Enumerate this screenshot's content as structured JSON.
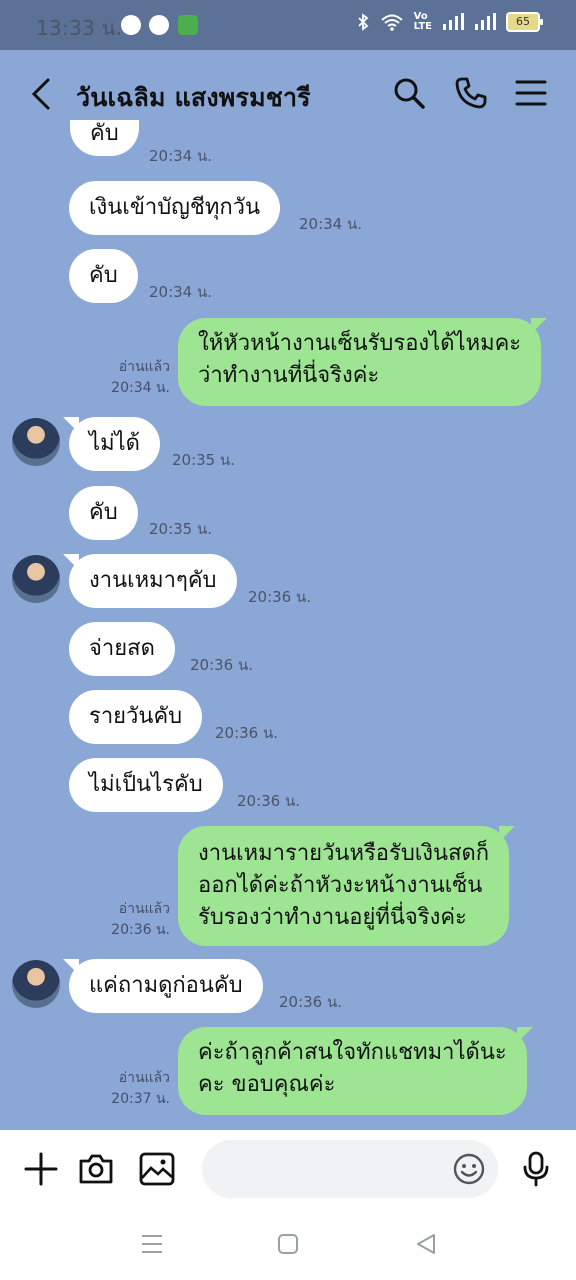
{
  "status": {
    "time": "13:33 น.",
    "battery": "65"
  },
  "header": {
    "title": "วันเฉลิม แสงพรมชารี"
  },
  "messages": [
    {
      "text": "คับ",
      "time": "20:34 น."
    },
    {
      "text": "เงินเข้าบัญชีทุกวัน",
      "time": "20:34 น."
    },
    {
      "text": "คับ",
      "time": "20:34 น."
    },
    {
      "lines": [
        "ให้หัวหน้างานเซ็นรับรองได้ไหมคะ",
        "ว่าทำงานที่นี่จริงค่ะ"
      ],
      "read": "อ่านแล้ว",
      "time": "20:34 น."
    },
    {
      "text": "ไม่ได้",
      "time": "20:35 น."
    },
    {
      "text": "คับ",
      "time": "20:35 น."
    },
    {
      "text": "งานเหมาๆคับ",
      "time": "20:36 น."
    },
    {
      "text": "จ่ายสด",
      "time": "20:36 น."
    },
    {
      "text": "รายวันคับ",
      "time": "20:36 น."
    },
    {
      "text": "ไม่เป็นไรคับ",
      "time": "20:36 น."
    },
    {
      "lines": [
        "งานเหมารายวันหรือรับเงินสดก็",
        "ออกได้ค่ะถ้าหัวงะหน้างานเซ็น",
        "รับรองว่าทำงานอยู่ที่นี่จริงค่ะ"
      ],
      "read": "อ่านแล้ว",
      "time": "20:36 น."
    },
    {
      "text": "แค่ถามดูก่อนคับ",
      "time": "20:36 น."
    },
    {
      "lines": [
        "ค่ะถ้าลูกค้าสนใจทักแชทมาได้นะ",
        "คะ ขอบคุณค่ะ"
      ],
      "read": "อ่านแล้ว",
      "time": "20:37 น."
    }
  ],
  "input": {
    "placeholder": ""
  },
  "icons": {
    "back": "chevron-left-icon",
    "search": "search-icon",
    "call": "phone-icon",
    "menu": "menu-icon",
    "add": "plus-icon",
    "camera": "camera-icon",
    "image": "image-icon",
    "emoji": "smile-icon",
    "mic": "microphone-icon"
  },
  "colors": {
    "background": "#8aa7d6",
    "outgoing": "#9de493",
    "incoming": "#ffffff"
  }
}
